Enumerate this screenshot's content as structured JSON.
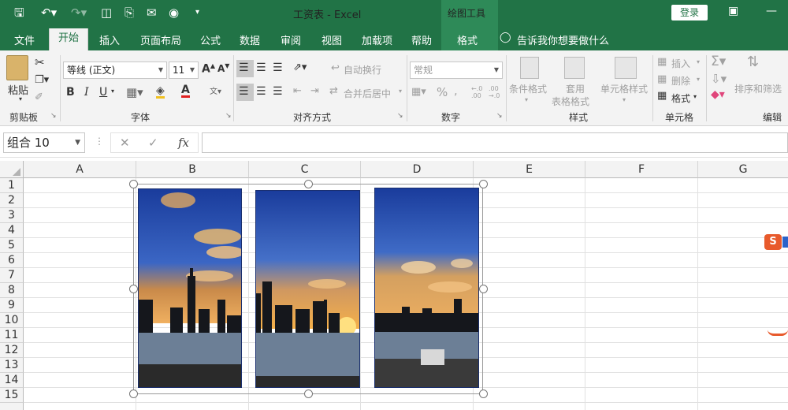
{
  "titlebar": {
    "doc_title": "工资表 - Excel",
    "context_title": "绘图工具",
    "login_label": "登录"
  },
  "tabs": [
    "文件",
    "开始",
    "插入",
    "页面布局",
    "公式",
    "数据",
    "审阅",
    "视图",
    "加载项",
    "帮助",
    "格式"
  ],
  "active_tab": "开始",
  "tell_me": "告诉我你想要做什么",
  "ribbon": {
    "clipboard": {
      "label": "剪贴板",
      "paste": "粘贴"
    },
    "font": {
      "label": "字体",
      "name": "等线 (正文)",
      "size": "11",
      "bold": "B",
      "italic": "I",
      "underline": "U"
    },
    "alignment": {
      "label": "对齐方式",
      "wrap": "自动换行",
      "merge": "合并后居中"
    },
    "number": {
      "label": "数字",
      "format": "常规"
    },
    "styles": {
      "label": "样式",
      "cond": "条件格式",
      "table_line1": "套用",
      "table_line2": "表格格式",
      "cell": "单元格样式"
    },
    "cells": {
      "label": "单元格",
      "insert": "插入",
      "delete": "删除",
      "format": "格式"
    },
    "editing": {
      "label": "编辑",
      "sort": "排序和筛选"
    }
  },
  "formula_bar": {
    "name_box": "组合 10",
    "fx": "fx"
  },
  "columns": [
    "A",
    "B",
    "C",
    "D",
    "E",
    "F",
    "G"
  ],
  "rows": [
    "1",
    "2",
    "3",
    "4",
    "5",
    "6",
    "7",
    "8",
    "9",
    "10",
    "11",
    "12",
    "13",
    "14",
    "15"
  ],
  "colors": {
    "accent": "#217346",
    "sky_top": "#1a3c9c",
    "sky_glow": "#f5b04a",
    "water": "#6c7f96"
  }
}
